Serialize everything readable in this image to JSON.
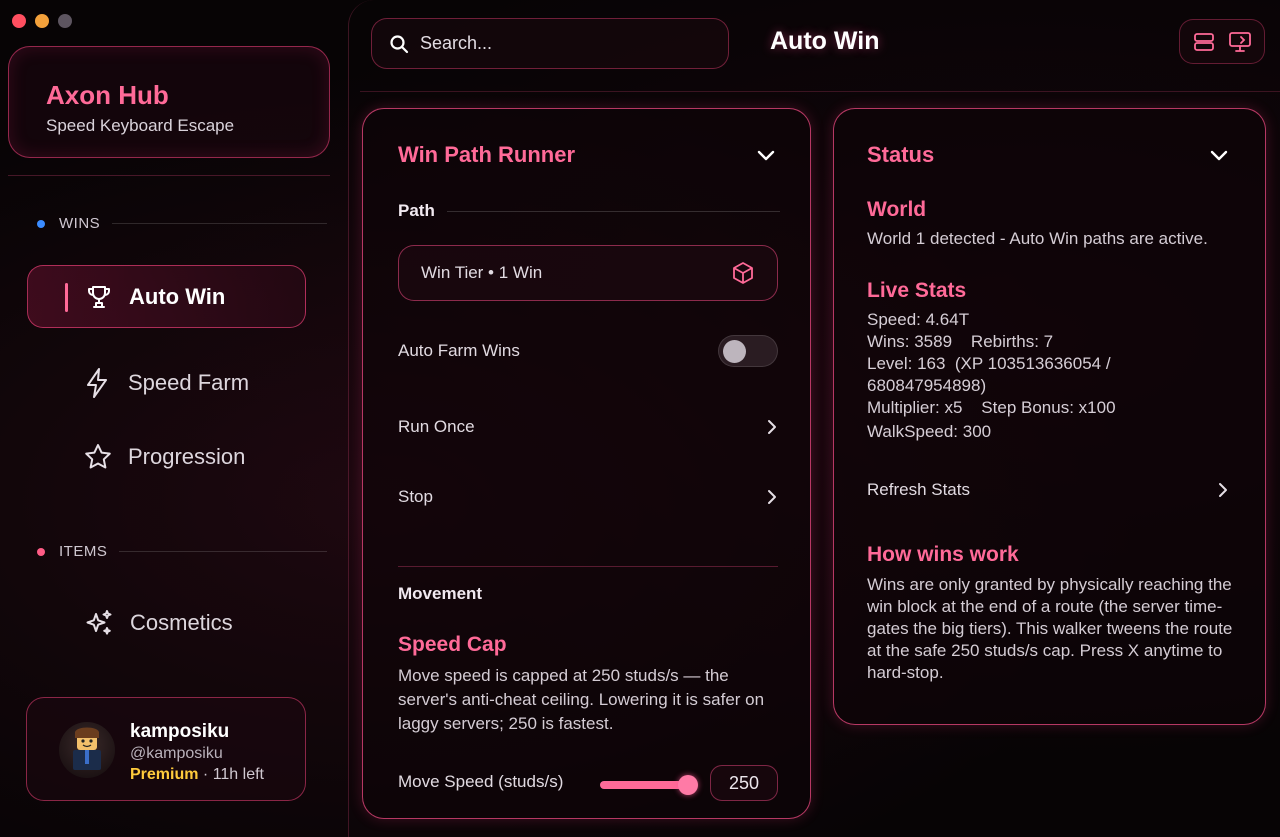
{
  "sidebar": {
    "brand_title": "Axon Hub",
    "brand_subtitle": "Speed Keyboard Escape",
    "sections": [
      {
        "label": "WINS",
        "dot_color": "#3b8cff"
      },
      {
        "label": "ITEMS",
        "dot_color": "#ff5c86"
      }
    ],
    "items": [
      {
        "label": "Auto Win",
        "icon": "trophy-icon",
        "active": true
      },
      {
        "label": "Speed Farm",
        "icon": "lightning-icon",
        "active": false
      },
      {
        "label": "Progression",
        "icon": "star-icon",
        "active": false
      },
      {
        "label": "Cosmetics",
        "icon": "sparkles-icon",
        "active": false
      }
    ],
    "user": {
      "name": "kamposiku",
      "handle": "@kamposiku",
      "plan": "Premium",
      "time_left": "· 11h left"
    }
  },
  "header": {
    "search_placeholder": "Search...",
    "title": "Auto Win",
    "actions": [
      "layout-icon",
      "monitor-icon"
    ]
  },
  "win_path_runner": {
    "title": "Win Path Runner",
    "path_label": "Path",
    "path_value": "Win Tier • 1 Win",
    "auto_farm_label": "Auto Farm Wins",
    "auto_farm_enabled": false,
    "run_once_label": "Run Once",
    "stop_label": "Stop",
    "movement_label": "Movement",
    "speed_cap_title": "Speed Cap",
    "speed_cap_text": "Move speed is capped at 250 studs/s — the server's anti-cheat ceiling. Lowering it is safer on laggy servers; 250 is fastest.",
    "move_speed_label": "Move Speed (studs/s)",
    "move_speed_value": "250",
    "move_speed_fraction": 1.0
  },
  "status": {
    "title": "Status",
    "world_title": "World",
    "world_text": "World 1 detected - Auto Win paths are active.",
    "live_stats_title": "Live Stats",
    "stats": {
      "speed": "Speed: 4.64T",
      "wins_rebirths": "Wins: 3589    Rebirths: 7",
      "level_a": "Level: 163  (XP 103513636054 /",
      "level_b": "680847954898)",
      "multiplier": "Multiplier: x5    Step Bonus: x100",
      "walkspeed": "WalkSpeed: 300"
    },
    "refresh_label": "Refresh Stats",
    "how_title": "How wins work",
    "how_text": "Wins are only granted by physically reaching the win block at the end of a route (the server time-gates the big tiers). This walker tweens the route at the safe 250 studs/s cap. Press X anytime to hard-stop."
  },
  "colors": {
    "accent": "#ff6a98",
    "premium": "#ffcb3c",
    "background": "#070405"
  }
}
